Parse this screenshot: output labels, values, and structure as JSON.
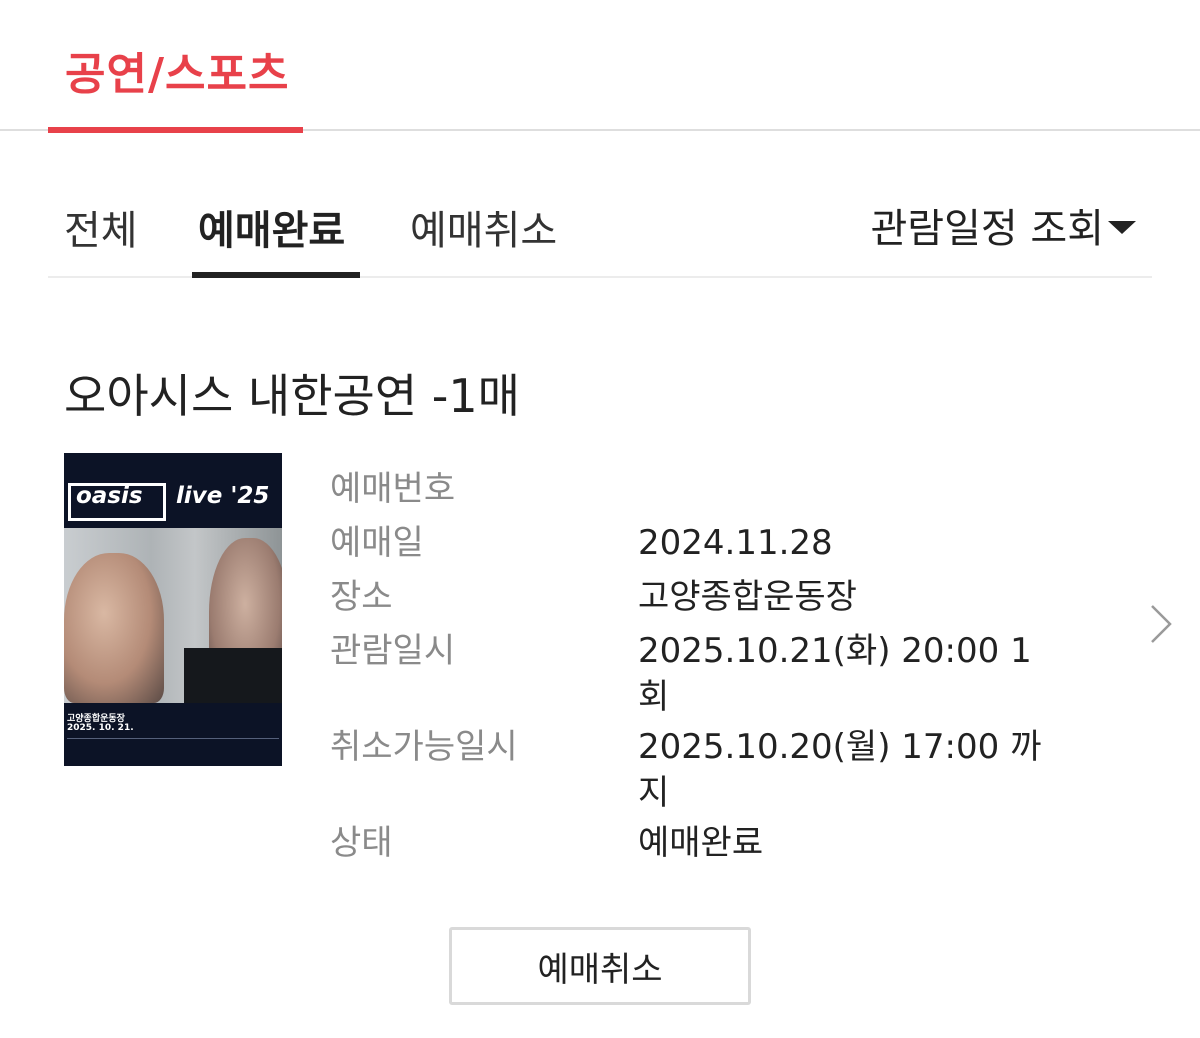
{
  "category_tab": {
    "label": "공연/스포츠",
    "accent_color": "#e8414a"
  },
  "filter_tabs": [
    {
      "label": "전체",
      "active": false
    },
    {
      "label": "예매완료",
      "active": true
    },
    {
      "label": "예매취소",
      "active": false
    }
  ],
  "sort_dropdown": {
    "label": "관람일정 조회",
    "icon": "caret-down-icon"
  },
  "event": {
    "title": "오아시스 내한공연 -1매",
    "poster": {
      "logo": "oasis",
      "tagline": "live '25",
      "venue": "고양종합운동장",
      "date": "2025. 10. 21."
    },
    "details": [
      {
        "label": "예매번호",
        "value": ""
      },
      {
        "label": "예매일",
        "value": "2024.11.28"
      },
      {
        "label": "장소",
        "value": "고양종합운동장"
      },
      {
        "label": "관람일시",
        "value": "2025.10.21(화) 20:00 1회"
      },
      {
        "label": "취소가능일시",
        "value": "2025.10.20(월) 17:00 까지"
      },
      {
        "label": "상태",
        "value": "예매완료"
      }
    ]
  },
  "cancel_button": {
    "label": "예매취소"
  },
  "icons": {
    "chevron": "chevron-right-icon"
  }
}
